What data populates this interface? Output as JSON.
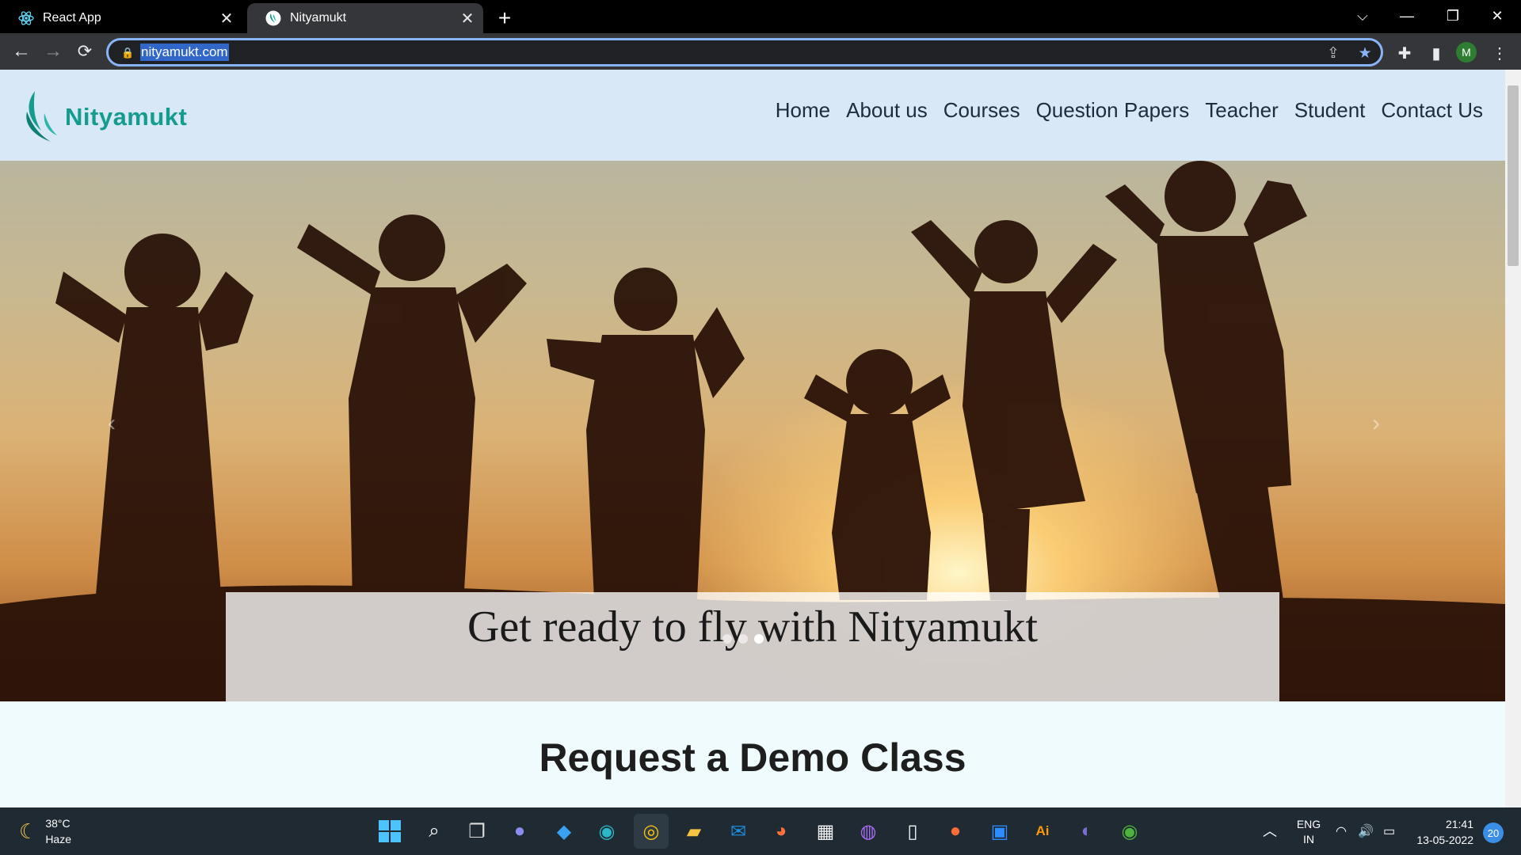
{
  "browser": {
    "tabs": [
      {
        "label": "React App",
        "favicon": "react-icon",
        "active": false
      },
      {
        "label": "Nityamukt",
        "favicon": "nityamukt-favicon",
        "active": true
      }
    ],
    "address": "nityamukt.com",
    "profile_initial": "M",
    "colors": {
      "accent": "#8ab4f8",
      "tab_active": "#35363a"
    }
  },
  "site": {
    "brand": "Nityamukt",
    "nav": [
      "Home",
      "About us",
      "Courses",
      "Question Papers",
      "Teacher",
      "Student",
      "Contact Us"
    ],
    "hero": {
      "caption": "Get ready to fly with Nityamukt",
      "prev": "‹",
      "next": "›",
      "slides_count": 3,
      "active_slide": 3
    },
    "section_title": "Request a Demo Class",
    "colors": {
      "navbar_bg": "#d8e8f7",
      "brand": "#169c8f",
      "page_bg": "#f0fbfd"
    }
  },
  "taskbar": {
    "weather_temp": "38°C",
    "weather_desc": "Haze",
    "lang_1": "ENG",
    "lang_2": "IN",
    "time": "21:41",
    "date": "13-05-2022",
    "notifications": "20",
    "apps": [
      "windows-start-icon",
      "search-icon",
      "task-view-icon",
      "teams-chat-icon",
      "vscode-icon",
      "edge-icon",
      "chrome-icon",
      "file-explorer-icon",
      "mail-icon",
      "firefox-icon",
      "ms-store-icon",
      "github-desktop-icon",
      "notepad-icon",
      "postman-icon",
      "zoom-icon",
      "illustrator-icon",
      "eclipse-icon",
      "mongodb-compass-icon"
    ]
  }
}
